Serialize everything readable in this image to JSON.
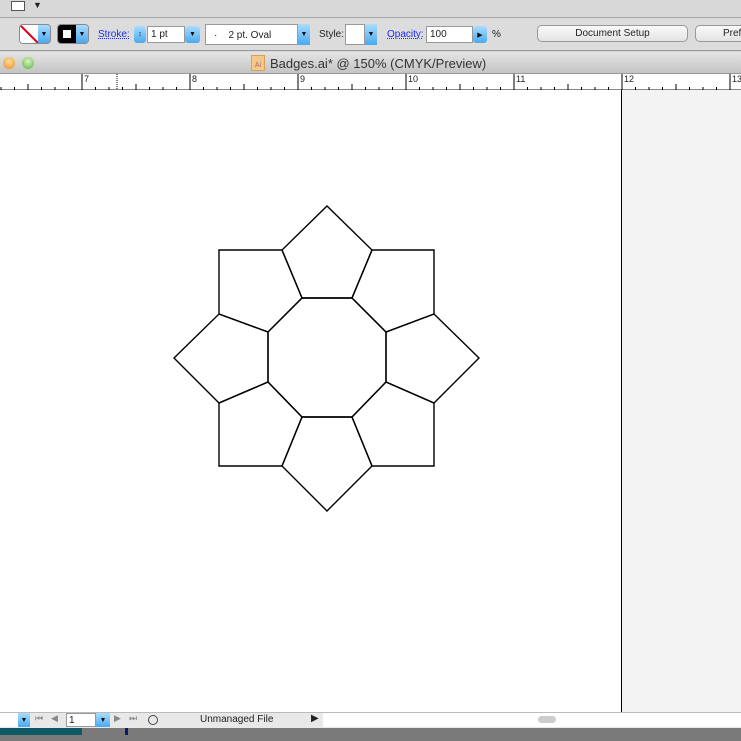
{
  "controls": {
    "stroke_label": "Stroke:",
    "stroke_weight": "1 pt",
    "brush": "·    2 pt. Oval",
    "style_label": "Style:",
    "opacity_label": "Opacity:",
    "opacity_value": "100",
    "percent": "%",
    "document_setup": "Document Setup",
    "preferences": "Prefe"
  },
  "window": {
    "title": "Badges.ai* @ 150% (CMYK/Preview)",
    "file_icon": "Ai"
  },
  "ruler": {
    "labels": [
      "7",
      "8",
      "9",
      "10",
      "11",
      "12",
      "13"
    ]
  },
  "status": {
    "page": "1",
    "file_status": "Unmanaged File"
  },
  "colors": {
    "accent": "#4aa9ef",
    "stroke_none": "#e0001b"
  }
}
